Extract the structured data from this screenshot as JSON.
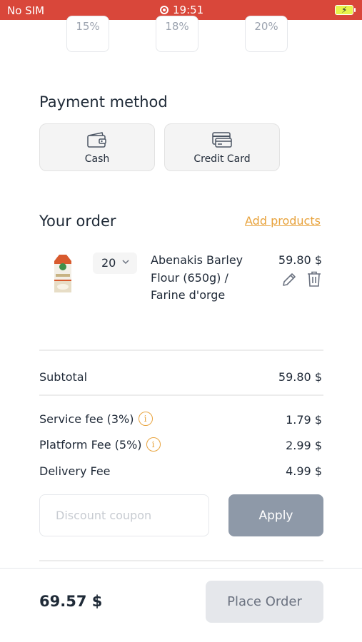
{
  "status_bar": {
    "carrier": "No SIM",
    "time": "19:51"
  },
  "tips": [
    "15%",
    "18%",
    "20%"
  ],
  "payment": {
    "title": "Payment method",
    "options": [
      {
        "label": "Cash",
        "icon": "wallet-icon"
      },
      {
        "label": "Credit Card",
        "icon": "credit-card-icon"
      }
    ]
  },
  "order": {
    "title": "Your order",
    "add_products": "Add products",
    "items": [
      {
        "quantity": "20",
        "name": "Abenakis Barley Flour (650g) / Farine d'orge",
        "price": "59.80 $"
      }
    ]
  },
  "summary": {
    "subtotal_label": "Subtotal",
    "subtotal_value": "59.80 $",
    "service_fee_label": "Service fee (3%)",
    "service_fee_value": "1.79 $",
    "platform_fee_label": "Platform Fee (5%)",
    "platform_fee_value": "2.99 $",
    "delivery_fee_label": "Delivery Fee",
    "delivery_fee_value": "4.99 $"
  },
  "coupon": {
    "placeholder": "Discount coupon",
    "apply_label": "Apply"
  },
  "footer": {
    "total": "69.57 $",
    "place_order_label": "Place Order"
  },
  "colors": {
    "status_bar": "#d9473a",
    "accent": "#e8a33d",
    "apply_button": "#8e99a8",
    "place_order_button": "#e5e7eb"
  }
}
